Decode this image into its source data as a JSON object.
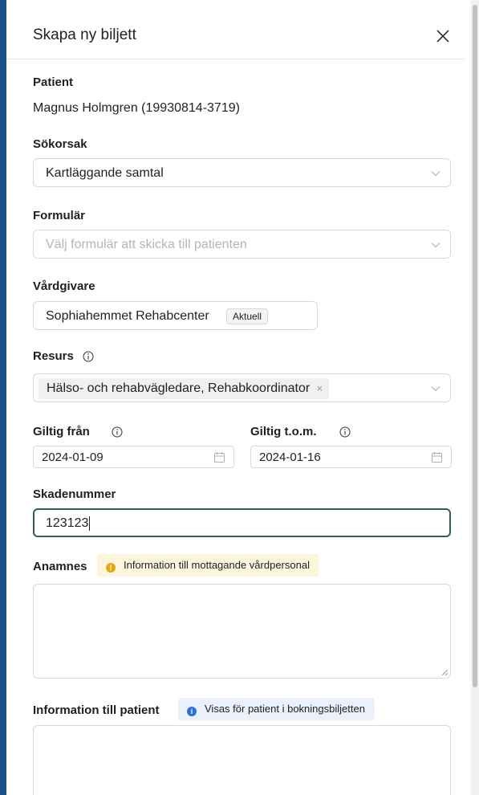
{
  "modal": {
    "title": "Skapa ny biljett"
  },
  "patient": {
    "label": "Patient",
    "value": "Magnus Holmgren (19930814-3719)"
  },
  "reason": {
    "label": "Sökorsak",
    "value": "Kartläggande samtal"
  },
  "form": {
    "label": "Formulär",
    "placeholder": "Välj formulär att skicka till patienten"
  },
  "caregiver": {
    "label": "Vårdgivare",
    "value": "Sophiahemmet Rehabcenter",
    "badge": "Aktuell"
  },
  "resource": {
    "label": "Resurs",
    "tag": "Hälso- och rehabvägledare, Rehabkoordinator",
    "remove": "×"
  },
  "valid_from": {
    "label": "Giltig från",
    "value": "2024-01-09"
  },
  "valid_to": {
    "label": "Giltig t.o.m.",
    "value": "2024-01-16"
  },
  "claim_number": {
    "label": "Skadenummer",
    "value": "123123"
  },
  "anamnesis": {
    "label": "Anamnes",
    "note": "Information till mottagande vårdpersonal",
    "note_color": "#fbf6dd",
    "icon_color": "#e6a817"
  },
  "patient_info": {
    "label": "Information till patient",
    "note": "Visas för patient i bokningsbiljetten",
    "note_color": "#eaf1fb",
    "icon_color": "#2f6fd6"
  },
  "colors": {
    "frame": "#1f4e8c",
    "focus_border": "#2f5e5e"
  }
}
